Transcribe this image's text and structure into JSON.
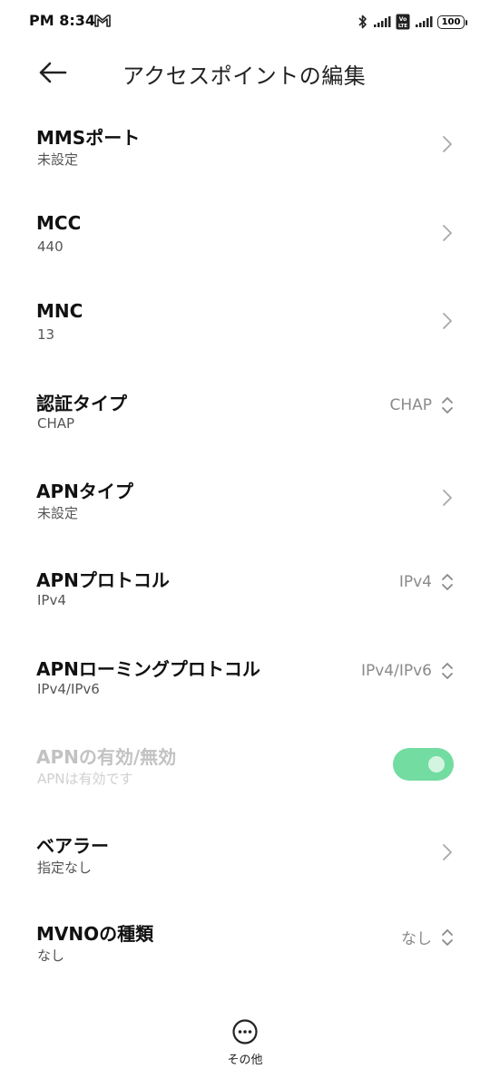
{
  "status_bar": {
    "time": "PM 8:34",
    "battery": "100",
    "volte_label": "Vo LTE",
    "icons": [
      "gmail-icon",
      "bluetooth-icon",
      "signal-icon",
      "volte-icon",
      "signal-icon",
      "battery-icon"
    ]
  },
  "header": {
    "title": "アクセスポイントの編集",
    "back_icon": "arrow-left-icon"
  },
  "settings": [
    {
      "title": "MMSポート",
      "subtitle": "未設定",
      "control": "chevron"
    },
    {
      "title": "MCC",
      "subtitle": "440",
      "control": "chevron"
    },
    {
      "title": "MNC",
      "subtitle": "13",
      "control": "chevron"
    },
    {
      "title": "認証タイプ",
      "subtitle": "CHAP",
      "control": "select",
      "value": "CHAP"
    },
    {
      "title": "APNタイプ",
      "subtitle": "未設定",
      "control": "chevron"
    },
    {
      "title": "APNプロトコル",
      "subtitle": "IPv4",
      "control": "select",
      "value": "IPv4"
    },
    {
      "title": "APNローミングプロトコル",
      "subtitle": "IPv4/IPv6",
      "control": "select",
      "value": "IPv4/IPv6"
    },
    {
      "title": "APNの有効/無効",
      "subtitle": "APNは有効です",
      "control": "toggle",
      "enabled": true,
      "disabled_row": true
    },
    {
      "title": "ベアラー",
      "subtitle": "指定なし",
      "control": "chevron"
    },
    {
      "title": "MVNOの種類",
      "subtitle": "なし",
      "control": "select",
      "value": "なし"
    }
  ],
  "bottom": {
    "more_label": "その他",
    "more_icon": "more-dots-icon"
  },
  "colors": {
    "toggle_on": "#72dca1",
    "value_text": "#8a8a8a",
    "disabled_text": "#c2c2c2"
  }
}
